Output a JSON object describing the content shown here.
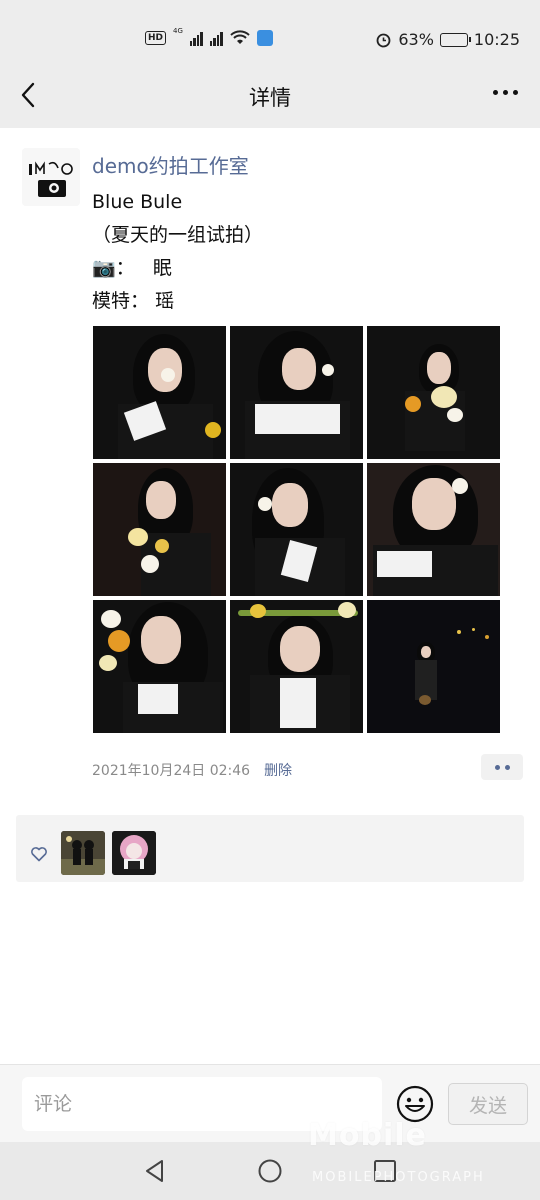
{
  "status_bar": {
    "hd_badge": "HD",
    "network_type": "4G",
    "battery_percent": "63%",
    "time": "10:25"
  },
  "nav": {
    "title": "详情"
  },
  "post": {
    "author": "demo约拍工作室",
    "title_line": "Blue  Bule",
    "subtitle_line": "（夏天的一组试拍）",
    "camera_label": "：",
    "camera_value": "眠",
    "model_label": "模特：",
    "model_value": "瑶",
    "photo_count": 9,
    "timestamp": "2021年10月24日 02:46",
    "delete_label": "删除"
  },
  "likes": {
    "count": 2
  },
  "comment": {
    "placeholder": "评论",
    "send_label": "发送"
  },
  "watermark": {
    "text": "Mobile",
    "sub": "MOBILEPHOTOGRAPH"
  },
  "colors": {
    "link": "#576b95",
    "nav_bg": "#ededed"
  }
}
